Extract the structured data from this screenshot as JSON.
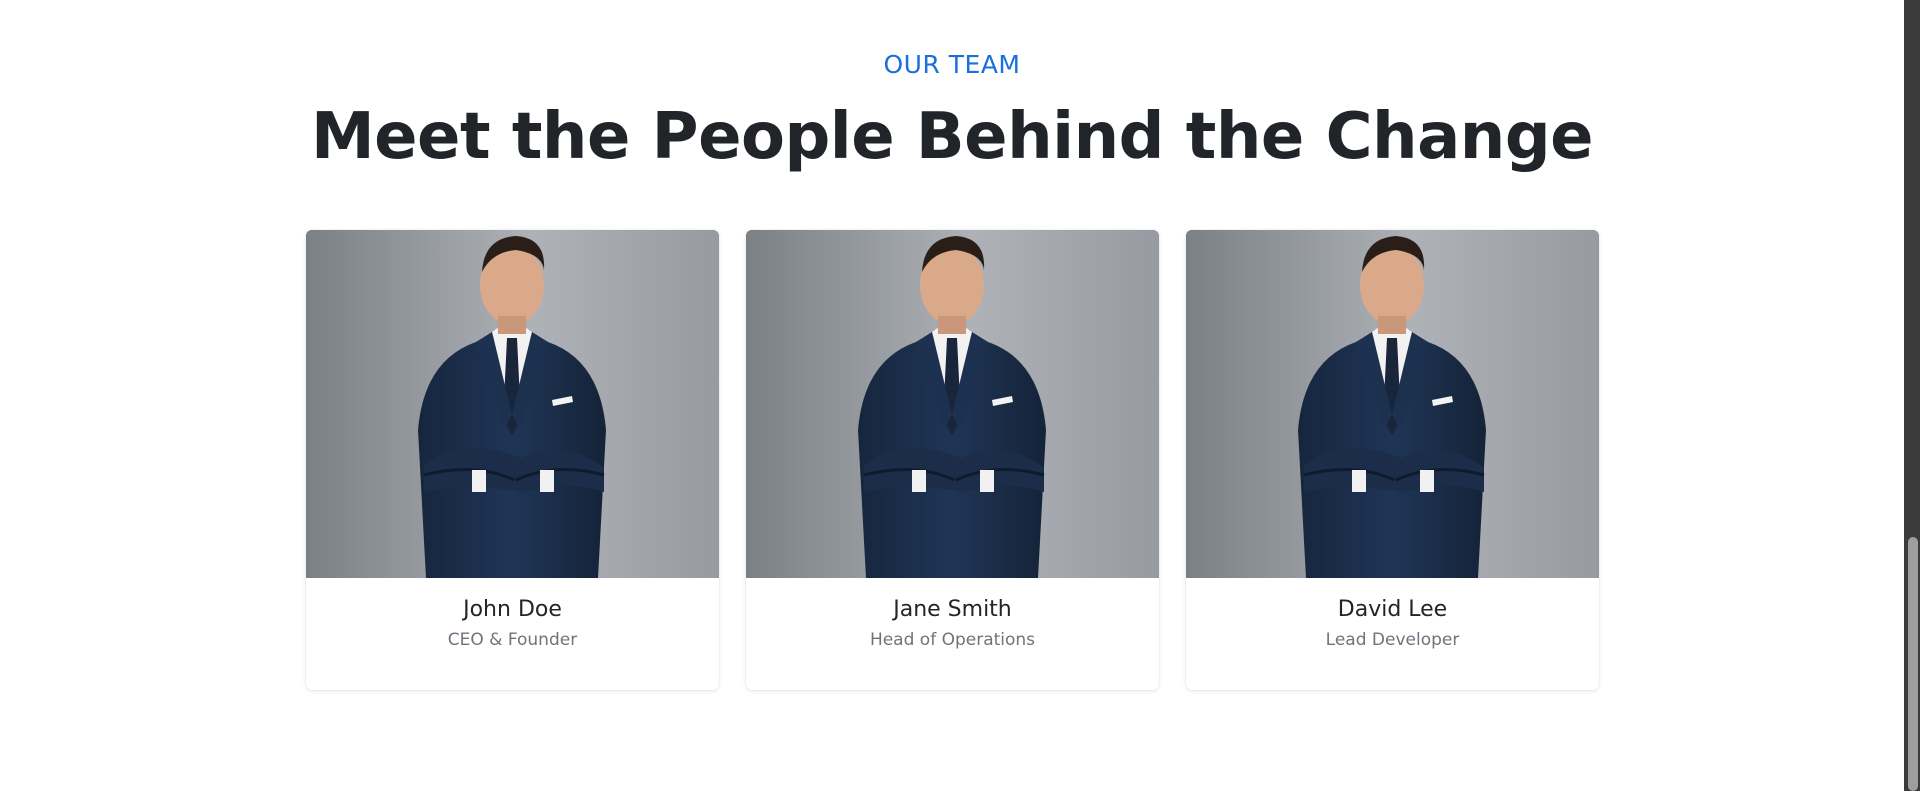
{
  "section": {
    "eyebrow": "OUR TEAM",
    "headline": "Meet the People Behind the Change"
  },
  "team": [
    {
      "name": "John Doe",
      "role": "CEO & Founder",
      "photo": "portrait of man in navy suit with arms crossed"
    },
    {
      "name": "Jane Smith",
      "role": "Head of Operations",
      "photo": "portrait of man in navy suit with arms crossed"
    },
    {
      "name": "David Lee",
      "role": "Lead Developer",
      "photo": "portrait of man in navy suit with arms crossed"
    }
  ],
  "colors": {
    "accent": "#1a6fdc",
    "heading": "#212529",
    "muted": "#6c757d",
    "suit": "#1f3556",
    "photo_bg": "#a3a7ad"
  }
}
